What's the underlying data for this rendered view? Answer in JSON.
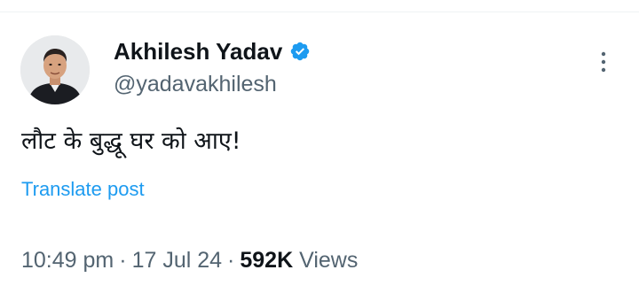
{
  "author": {
    "display_name": "Akhilesh Yadav",
    "handle": "@yadavakhilesh",
    "verified": true,
    "avatar_icon": "profile-photo"
  },
  "post": {
    "text": "लौट के बुद्धू घर को आए!",
    "translate_label": "Translate post"
  },
  "meta": {
    "time": "10:49 pm",
    "date": "17 Jul 24",
    "separator": "·",
    "views_count": "592K",
    "views_label": "Views"
  },
  "icons": {
    "verified": "verified-badge-icon",
    "more": "more-vertical-icon"
  },
  "colors": {
    "accent": "#1d9bf0",
    "secondary_text": "#536471",
    "primary_text": "#0f1419"
  }
}
